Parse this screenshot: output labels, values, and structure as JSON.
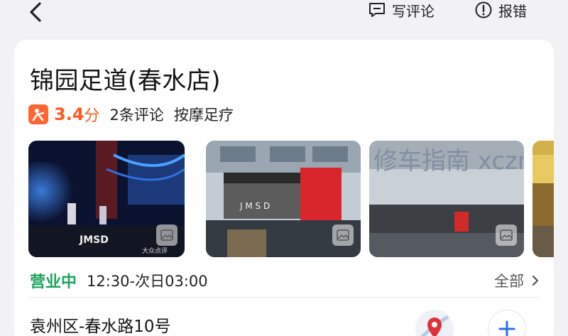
{
  "header": {
    "write_review": "写评论",
    "report_error": "报错"
  },
  "shop": {
    "name": "锦园足道(春水店)",
    "score": "3.4",
    "score_unit": "分",
    "reviews": "2条评论",
    "category": "按摩足疗"
  },
  "photos": [
    {
      "icon": "image-icon",
      "watermark": "大众点评"
    },
    {
      "icon": "image-icon"
    },
    {
      "icon": "image-icon",
      "watermark": "修车指南 xczn.xyz"
    },
    {
      "icon": "image-icon"
    }
  ],
  "hours": {
    "status": "营业中",
    "time": "12:30-次日03:00",
    "all_label": "全部"
  },
  "location": {
    "address": "袁州区-春水路10号"
  },
  "colors": {
    "accent_orange": "#ff5a1f",
    "open_green": "#1aa35c",
    "link_blue": "#2d6bf0"
  }
}
